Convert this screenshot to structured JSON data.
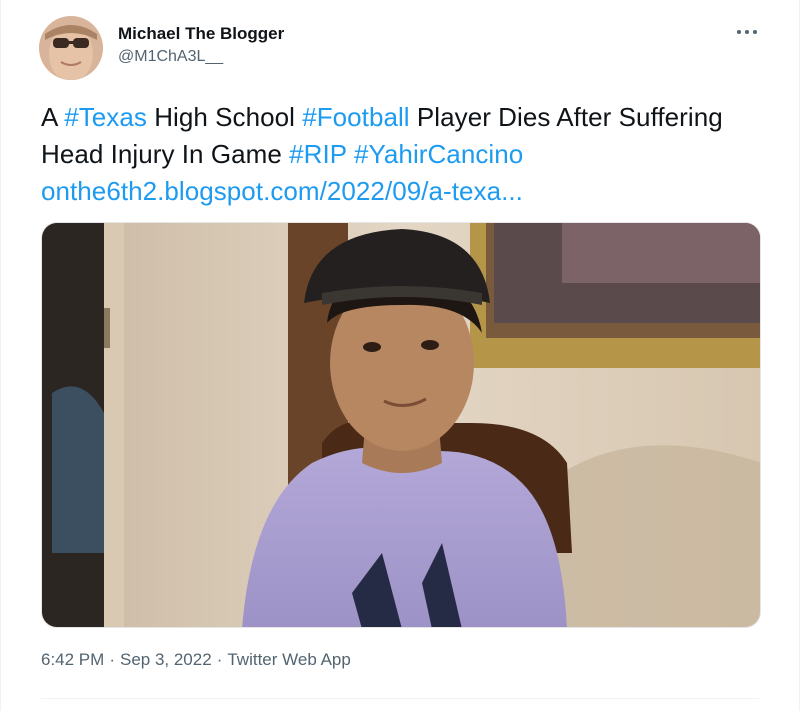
{
  "author": {
    "name": "Michael The Blogger",
    "handle": "@M1ChA3L__",
    "avatar_icon": "profile-photo-avatar"
  },
  "more_icon": "more-dots-icon",
  "tweet": {
    "text_1": "A ",
    "hashtag_1": "#Texas",
    "text_2": " High School ",
    "hashtag_2": "#Football",
    "text_3": " Player Dies After Suffering Head Injury In Game ",
    "hashtag_3": "#RIP",
    "text_4": " ",
    "hashtag_4": "#YahirCancino",
    "link": "onthe6th2.blogspot.com/2022/09/a-texa..."
  },
  "meta": {
    "time": "6:42 PM",
    "date": "Sep 3, 2022",
    "source": "Twitter Web App",
    "separator": "·"
  },
  "colors": {
    "link": "#1d9bf0",
    "secondary_text": "#536471",
    "primary_text": "#0f1419"
  }
}
